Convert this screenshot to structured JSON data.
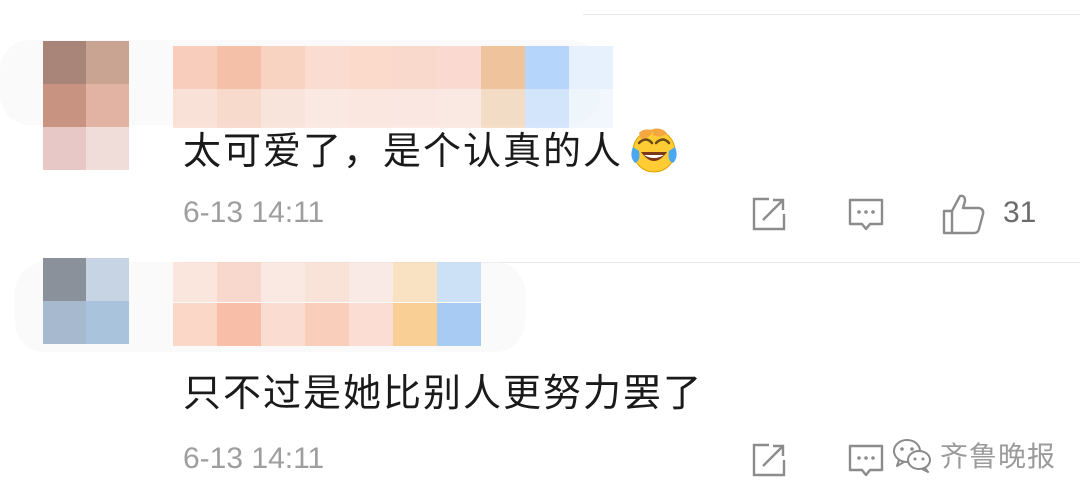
{
  "comments": [
    {
      "text": "太可爱了，是个认真的人",
      "emoji": "face-with-tears-of-joy",
      "timestamp": "6-13 14:11",
      "like_count": "31",
      "avatar_colors": [
        "#a98478",
        "#c9a493",
        "#c89380",
        "#e2b2a2",
        "#e8c8c6",
        "#f0dcd9"
      ],
      "name_colors": [
        "#f9cdbb",
        "#f5c0a8",
        "#f9d3c2",
        "#fbdcd0",
        "#fbdacc",
        "#fad9cd",
        "#fadad0",
        "#efc49d",
        "#b5d5fb",
        "#e6f1fd"
      ]
    },
    {
      "text": "只不过是她比别人更努力罢了",
      "timestamp": "6-13 14:11",
      "like_count": "",
      "avatar_colors": [
        "#8a919a",
        "#c6d4e4",
        "#a6b9cf",
        "#a9c3dd"
      ],
      "name_colors": [
        "#fbd7c7",
        "#f8bea7",
        "#fbdcd0",
        "#f9cfbc",
        "#fbddd4",
        "#f9cf95",
        "#a8cbf4"
      ]
    }
  ],
  "watermark": {
    "icon": "wechat-icon",
    "text": "齐鲁晚报"
  },
  "colors": {
    "text": "#1a1a1a",
    "meta": "#9e9e9e",
    "icon": "#8c8c8c",
    "divider": "#e8e8e8"
  }
}
